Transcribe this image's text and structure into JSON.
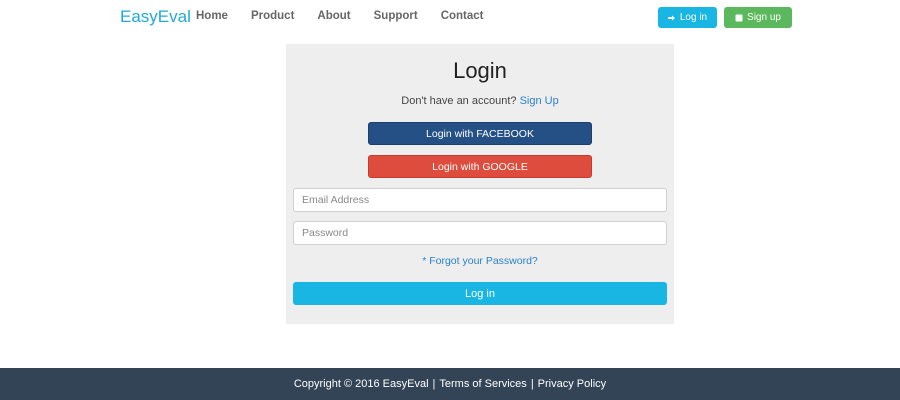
{
  "navbar": {
    "brand": "EasyEval",
    "links": [
      "Home",
      "Product",
      "About",
      "Support",
      "Contact"
    ],
    "login_label": "Log in",
    "signup_label": "Sign up"
  },
  "login_panel": {
    "title": "Login",
    "no_account_text": "Don't have an account?",
    "signup_link": "Sign Up",
    "facebook_button": "Login with FACEBOOK",
    "google_button": "Login with GOOGLE",
    "email_placeholder": "Email Address",
    "password_placeholder": "Password",
    "forgot_password": "* Forgot your Password?",
    "login_button": "Log in"
  },
  "footer": {
    "copyright": "Copyright © 2016 EasyEval",
    "separator": "|",
    "terms": "Terms of Services",
    "privacy": "Privacy Policy"
  },
  "colors": {
    "brand": "#1fa9d6",
    "primary": "#19b6e3",
    "success": "#5cb85c",
    "facebook": "#245086",
    "google": "#de4c3d",
    "footer_bg": "#334456"
  }
}
